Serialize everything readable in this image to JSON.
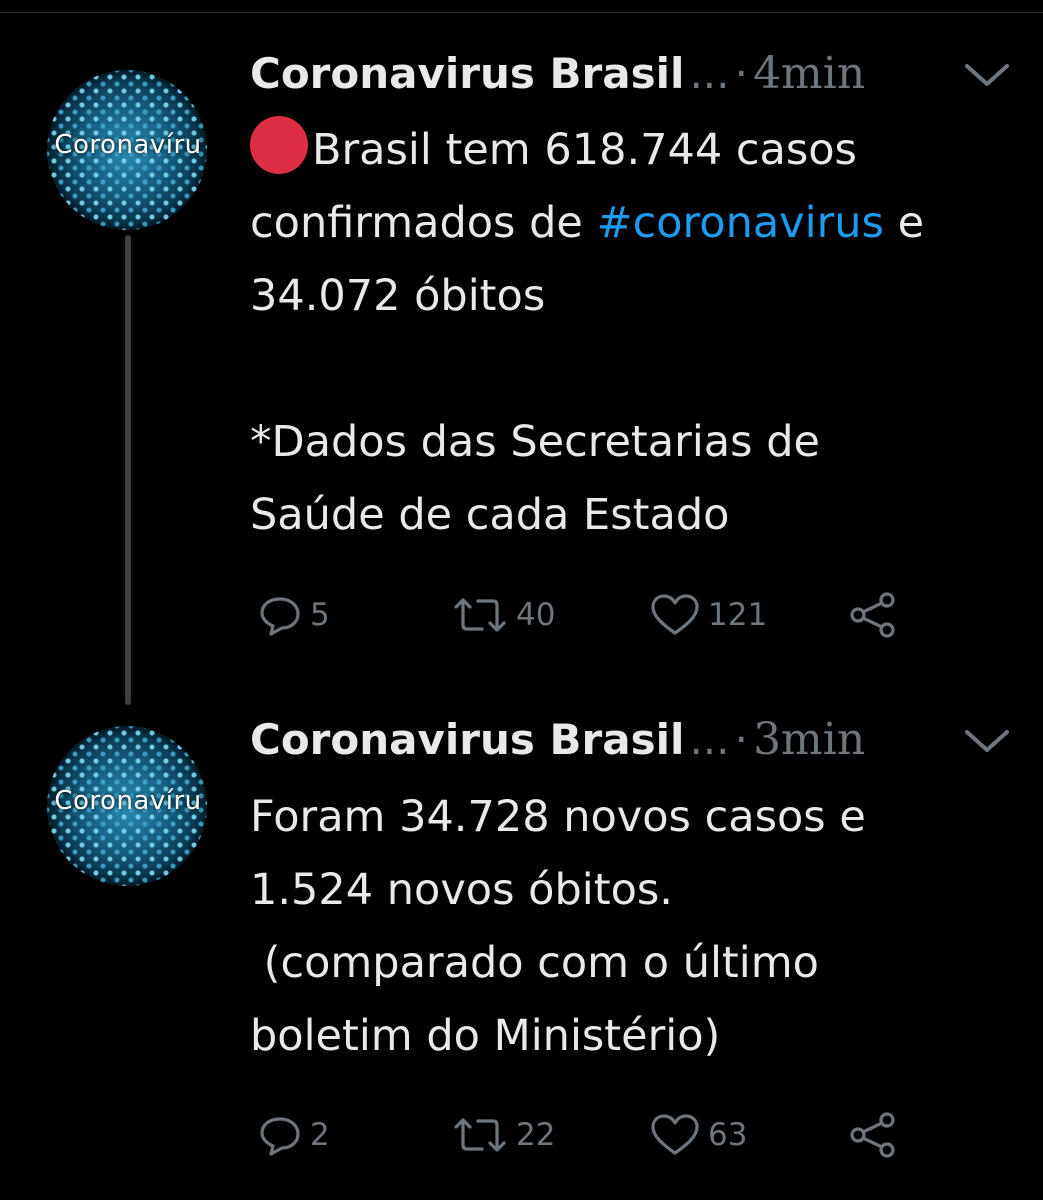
{
  "tweets": [
    {
      "author": "Coronavirus Brasil",
      "ellipsis": "...",
      "separator": "·",
      "time": "4min",
      "avatar_text": "Coronavíru",
      "text_line1": "Brasil tem 618.744 casos",
      "text_line2_a": "confirmados de ",
      "hashtag": "#coronavirus",
      "text_line2_b": " e",
      "text_line3": "34.072 óbitos",
      "text_line5": "*Dados das Secretarias de",
      "text_line6": "Saúde de cada Estado",
      "replies": "5",
      "retweets": "40",
      "likes": "121"
    },
    {
      "author": "Coronavirus Brasil",
      "ellipsis": "...",
      "separator": "·",
      "time": "3min",
      "avatar_text": "Coronavíru",
      "text_line1": "Foram 34.728 novos casos e",
      "text_line2": "1.524 novos óbitos.",
      "text_line3": " (comparado com o último",
      "text_line4": "boletim do Ministério)",
      "replies": "2",
      "retweets": "22",
      "likes": "63"
    }
  ],
  "icons": {
    "reply": "reply-icon",
    "retweet": "retweet-icon",
    "like": "heart-icon",
    "share": "share-icon",
    "more": "chevron-down-icon",
    "emoji": "red-circle-emoji"
  },
  "colors": {
    "background": "#000000",
    "text": "#e7e9ea",
    "secondary": "#6e767d",
    "link": "#1d9bf0",
    "thread_line": "#3d4146",
    "red_circle": "#dd2e44"
  }
}
